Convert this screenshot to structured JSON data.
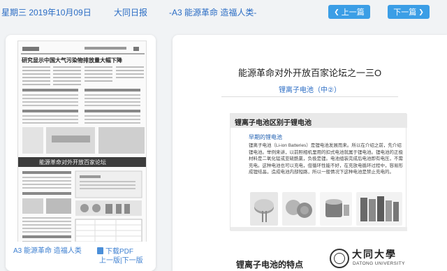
{
  "header": {
    "date": "星期三 2019年10月09日",
    "paper_name": "大同日报",
    "section": "-A3 能源革命 造福人类-",
    "prev_button": "上一篇",
    "next_button": "下一篇",
    "prev_icon": "chevron-left-icon",
    "next_icon": "chevron-right-icon"
  },
  "left_panel": {
    "thumb_title": "研究显示中国大气污染物排放量大幅下降",
    "thumb_banner": "能源革命对外开放百家论坛",
    "section_link": "A3 能源革命 造福人类",
    "download_pdf": "下载PDF",
    "prev_page": "上一版",
    "next_page": "下一版"
  },
  "article": {
    "title": "能源革命对外开放百家论坛之一三O",
    "subtitle": "锂离子电池（中②）",
    "slide": {
      "heading": "锂离子电池区别于锂电池",
      "subheading": "早期的锂电池",
      "body": "锂离子电池（Li-ion Batteries）是锂电池发展而来。所以在介绍之前，先介绍锂电池。举例来讲，以前照相机里用的扣式电池就属于锂电池。锂电池的正极材料是二氧化锰或亚硫酰氯，负极是锂。电池组装完成后电池即有电压，不需充电。这种电池也可以充电，但循环性能不好，在充放电循环过程中，容易形成锂结晶，造成电池内部短路，所以一般情况下这种电池是禁止充电的。"
    },
    "section_heading": "锂离子电池的特点",
    "logo": {
      "name_cn": "大同大學",
      "name_en": "DATONG UNIVERSITY"
    }
  },
  "colors": {
    "accent": "#2a6cc4",
    "button": "#3b9ee6",
    "background": "#f1f3f5"
  }
}
